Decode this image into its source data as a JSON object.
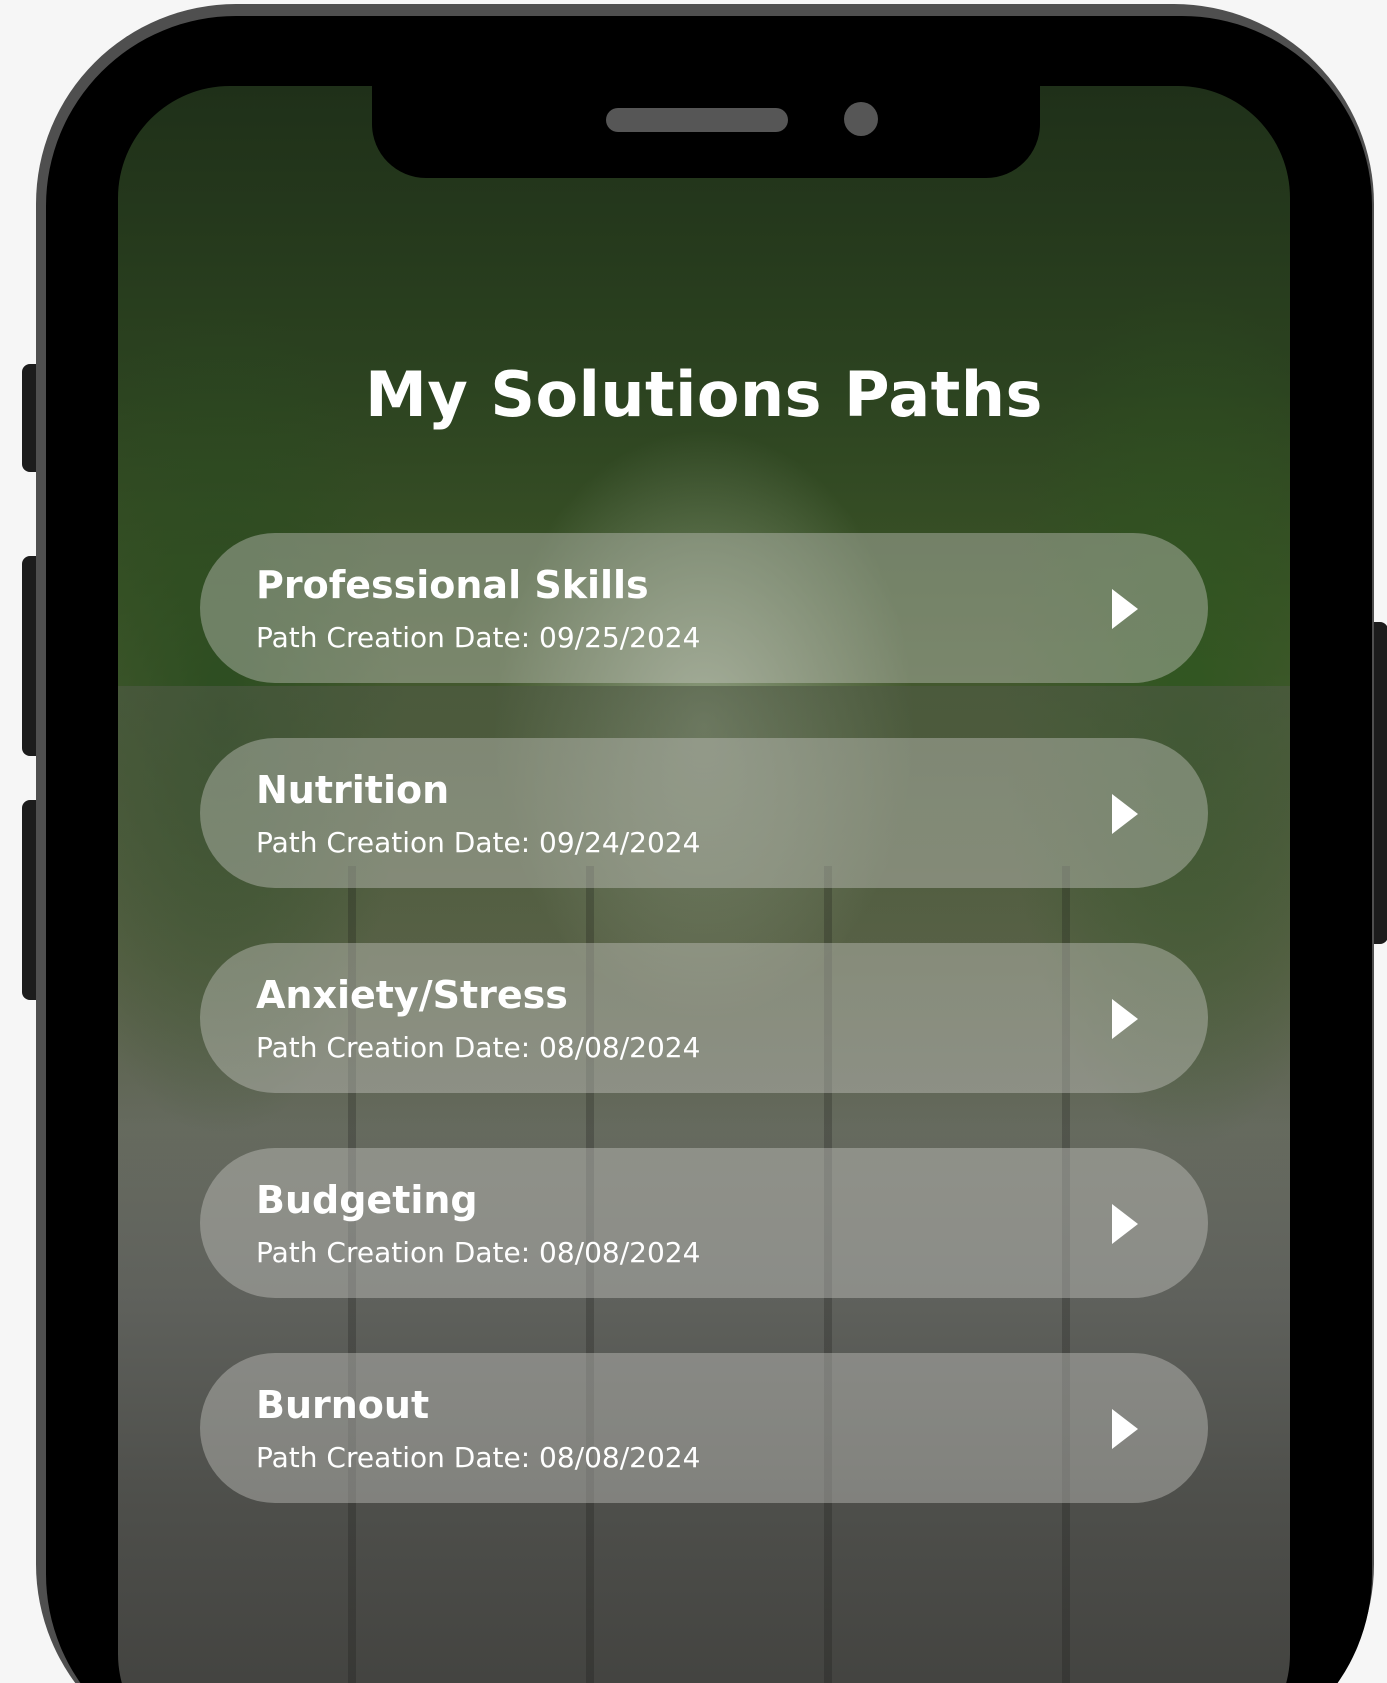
{
  "screen": {
    "title": "My Solutions Paths"
  },
  "paths": [
    {
      "name": "Professional Skills",
      "date": "Path Creation Date: 09/25/2024"
    },
    {
      "name": "Nutrition",
      "date": "Path Creation Date: 09/24/2024"
    },
    {
      "name": "Anxiety/Stress",
      "date": "Path Creation Date: 08/08/2024"
    },
    {
      "name": "Budgeting",
      "date": "Path Creation Date: 08/08/2024"
    },
    {
      "name": "Burnout",
      "date": "Path Creation Date: 08/08/2024"
    }
  ],
  "icons": {
    "open_path": "play-arrow-icon"
  },
  "colors": {
    "text": "#ffffff",
    "card": "#c8c8c3",
    "frame": "#4f4f4f"
  }
}
